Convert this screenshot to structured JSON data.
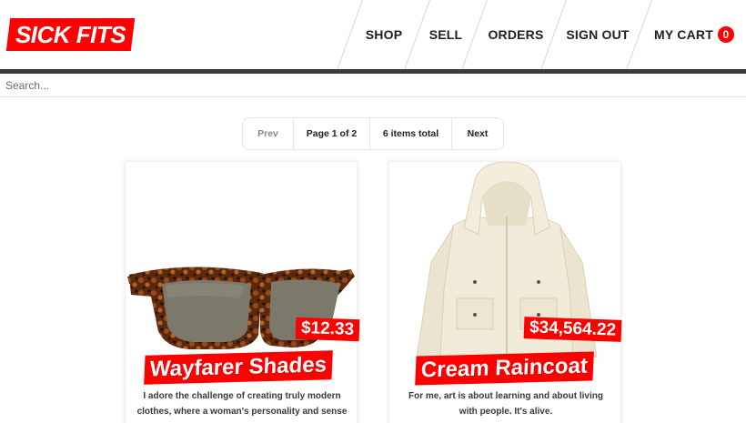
{
  "brand": {
    "logo_text": "SICK FITS",
    "accent_color": "#ff0000"
  },
  "nav": {
    "items": [
      {
        "label": "SHOP"
      },
      {
        "label": "SELL"
      },
      {
        "label": "ORDERS"
      },
      {
        "label": "SIGN OUT"
      },
      {
        "label": "MY CART"
      }
    ],
    "cart_count": "0"
  },
  "search": {
    "placeholder": "Search..."
  },
  "pagination": {
    "prev": "Prev",
    "page": "Page 1 of 2",
    "total": "6 items total",
    "next": "Next"
  },
  "products": [
    {
      "title": "Wayfarer Shades",
      "price": "$12.33",
      "description": "I adore the challenge of creating truly modern clothes, where a woman's personality and sense",
      "image_icon": "sunglasses-image"
    },
    {
      "title": "Cream Raincoat",
      "price": "$34,564.22",
      "description": "For me, art is about learning and about living with people. It's alive.",
      "image_icon": "raincoat-image"
    }
  ]
}
